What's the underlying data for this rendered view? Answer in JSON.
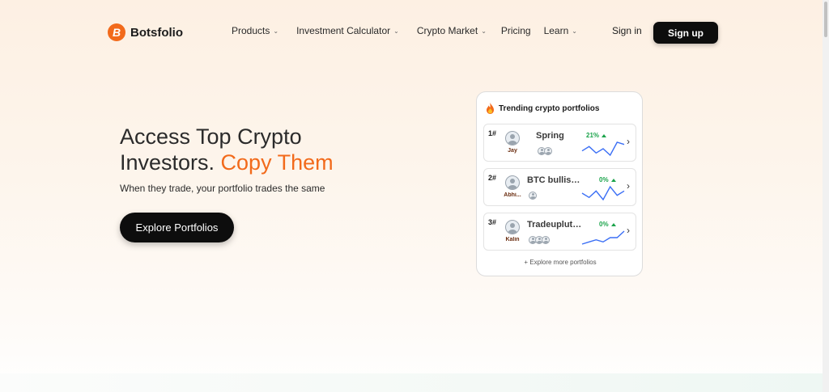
{
  "brand": {
    "name": "Botsfolio",
    "mark": "B",
    "accent": "#f26a1b"
  },
  "nav": {
    "items": [
      {
        "label": "Products",
        "dropdown": true
      },
      {
        "label": "Investment Calculator",
        "dropdown": true
      },
      {
        "label": "Crypto Market",
        "dropdown": true
      },
      {
        "label": "Pricing",
        "dropdown": false
      },
      {
        "label": "Learn",
        "dropdown": true
      }
    ],
    "signin": "Sign in",
    "signup": "Sign up"
  },
  "hero": {
    "title_line1": "Access Top Crypto",
    "title_line2": "Investors. ",
    "title_accent": "Copy Them",
    "subtitle": "When they trade, your portfolio trades the same",
    "cta": "Explore Portfolios"
  },
  "trending": {
    "title": "Trending crypto portfolios",
    "rows": [
      {
        "rank": "1#",
        "owner": "Jay",
        "name": "Spring",
        "change": "21%",
        "followers": 2,
        "trend": [
          5,
          7,
          4,
          6,
          3,
          9,
          8
        ]
      },
      {
        "rank": "2#",
        "owner": "Abhi...",
        "name": "BTC bullish ...",
        "change": "0%",
        "followers": 1,
        "trend": [
          5,
          3,
          6,
          2,
          8,
          4,
          6
        ]
      },
      {
        "rank": "3#",
        "owner": "Kalin",
        "name": "Tradeupluth...",
        "change": "0%",
        "followers": 3,
        "trend": [
          2,
          3,
          4,
          3,
          5,
          5,
          8
        ]
      }
    ],
    "more": "+ Explore more portfolios"
  }
}
